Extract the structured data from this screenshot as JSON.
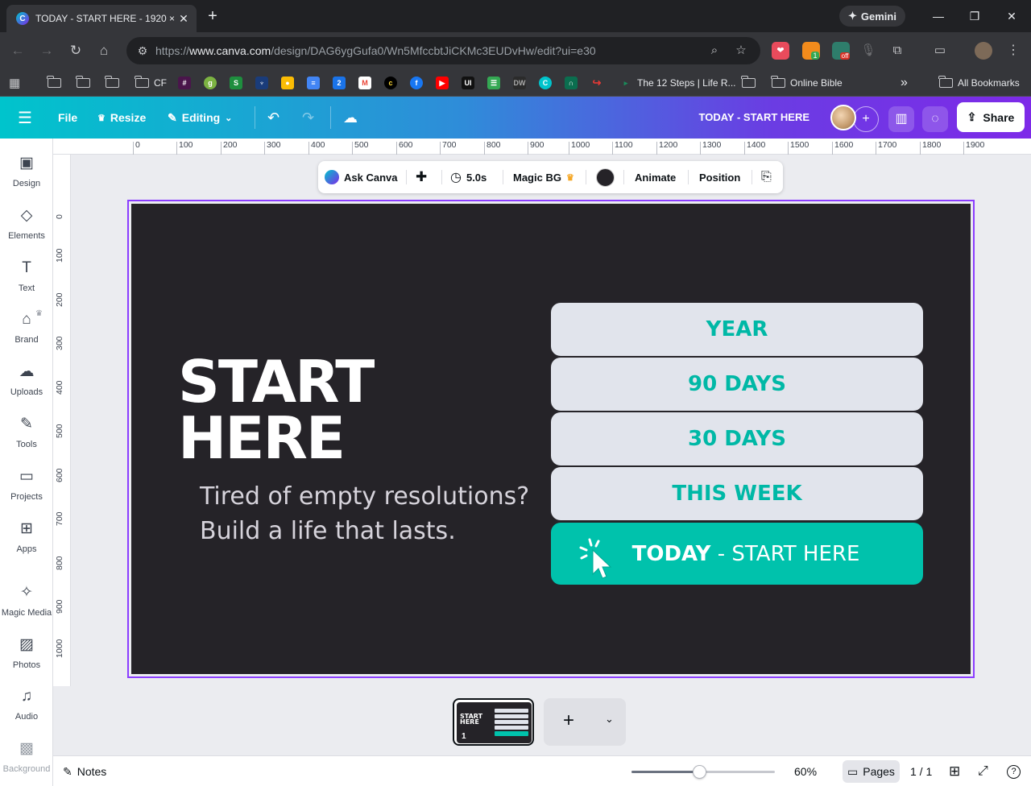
{
  "browser": {
    "tab_title": "TODAY - START HERE - 1920 ×",
    "url_prefix": "https://",
    "url_host": "www.canva.com",
    "url_path": "/design/DAG6ygGufa0/Wn5MfccbtJiCKMc3EUDvHw/edit?ui=e30",
    "gemini_label": "Gemini",
    "bookmarks": {
      "cf": "CF",
      "twelve_steps": "The 12 Steps | Life R...",
      "online_bible": "Online Bible",
      "all_bookmarks": "All Bookmarks"
    },
    "ext_badge": "1",
    "ext_off": "off"
  },
  "header": {
    "file_label": "File",
    "resize_label": "Resize",
    "editing_label": "Editing",
    "design_title": "TODAY - START HERE",
    "share_label": "Share"
  },
  "sidebar": {
    "items": [
      {
        "label": "Design",
        "icon": "design-icon"
      },
      {
        "label": "Elements",
        "icon": "elements-icon"
      },
      {
        "label": "Text",
        "icon": "text-icon"
      },
      {
        "label": "Brand",
        "icon": "brand-icon"
      },
      {
        "label": "Uploads",
        "icon": "uploads-icon"
      },
      {
        "label": "Tools",
        "icon": "tools-icon"
      },
      {
        "label": "Projects",
        "icon": "projects-icon"
      },
      {
        "label": "Apps",
        "icon": "apps-icon"
      },
      {
        "label": "Magic Media",
        "icon": "magic-media-icon"
      },
      {
        "label": "Photos",
        "icon": "photos-icon"
      },
      {
        "label": "Audio",
        "icon": "audio-icon"
      },
      {
        "label": "Background",
        "icon": "background-icon"
      }
    ]
  },
  "rulers": {
    "top": [
      "0",
      "100",
      "200",
      "300",
      "400",
      "500",
      "600",
      "700",
      "800",
      "900",
      "1000",
      "1100",
      "1200",
      "1300",
      "1400",
      "1500",
      "1600",
      "1700",
      "1800",
      "1900"
    ],
    "left": [
      "0",
      "100",
      "200",
      "300",
      "400",
      "500",
      "600",
      "700",
      "800",
      "900",
      "1000"
    ]
  },
  "context_toolbar": {
    "ask_canva": "Ask Canva",
    "duration": "5.0s",
    "magic_bg": "Magic BG",
    "animate": "Animate",
    "position": "Position",
    "bg_color": "#252328"
  },
  "design": {
    "hero_line1": "START",
    "hero_line2": "HERE",
    "sub_line1": "Tired of empty resolutions?",
    "sub_line2": "Build a life that lasts.",
    "pills": [
      "YEAR",
      "90 DAYS",
      "30 DAYS",
      "THIS WEEK"
    ],
    "today_bold": "TODAY",
    "today_rest": " - START HERE",
    "accent": "#00c2ac"
  },
  "bottom": {
    "notes_label": "Notes",
    "page_number": "1",
    "zoom_percent": "60%",
    "zoom_fraction": 0.47,
    "pages_label": "Pages",
    "page_counter": "1 / 1"
  }
}
